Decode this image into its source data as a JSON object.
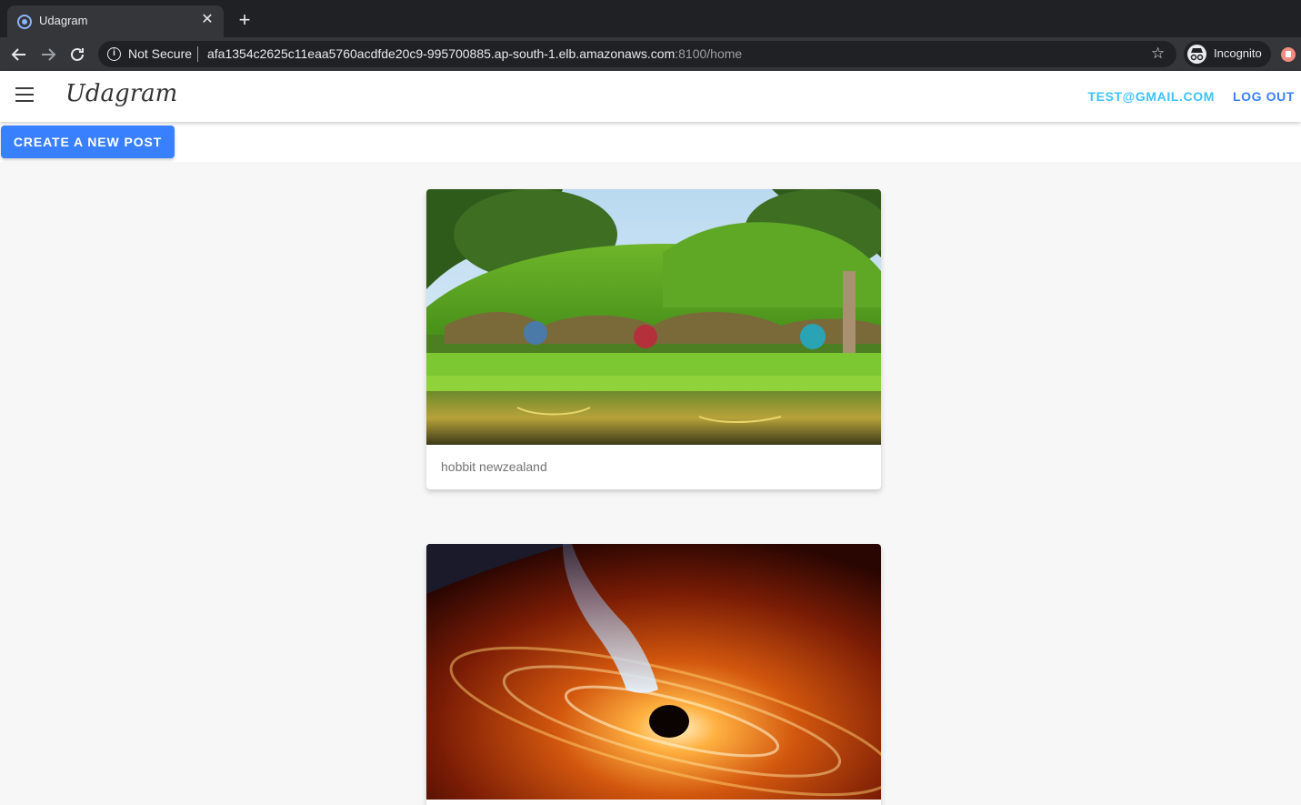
{
  "browser": {
    "tab_title": "Udagram",
    "security_label": "Not Secure",
    "url_host": "afa1354c2625c11eaa5760acdfde20c9-995700885.ap-south-1.elb.amazonaws.com",
    "url_path": ":8100/home",
    "profile_label": "Incognito"
  },
  "header": {
    "brand": "Udagram",
    "user_email": "TEST@GMAIL.COM",
    "logout_label": "LOG OUT"
  },
  "actions": {
    "create_post_label": "CREATE A NEW POST"
  },
  "feed": {
    "posts": [
      {
        "caption": "hobbit newzealand",
        "image": "hobbiton green hillside with round doors reflected in a pond"
      },
      {
        "caption": "",
        "image": "black hole with orange accretion disk and blue jet"
      }
    ]
  },
  "colors": {
    "primary": "#3880ff",
    "secondary": "#3dc2ff",
    "background": "#f7f7f7"
  }
}
